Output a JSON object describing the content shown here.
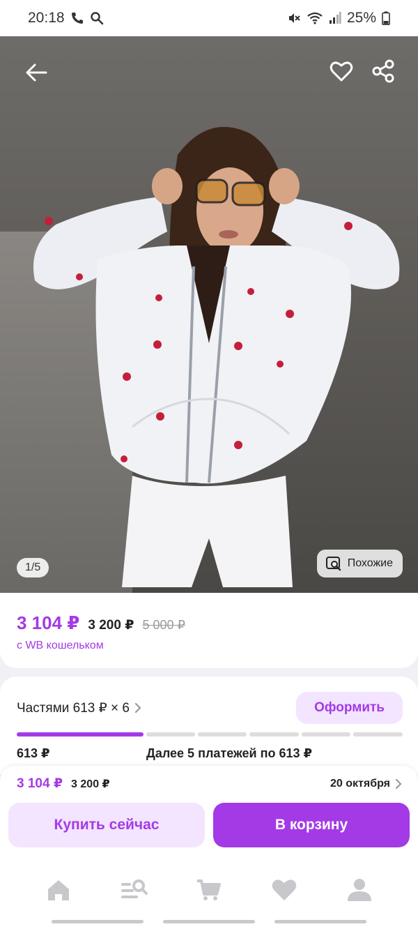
{
  "status_bar": {
    "time": "20:18",
    "battery": "25%"
  },
  "gallery": {
    "counter": "1/5",
    "similar_label": "Похожие",
    "icons": [
      "back-arrow-icon",
      "heart-outline-icon",
      "share-icon"
    ]
  },
  "price": {
    "wallet_price": "3 104 ₽",
    "price": "3 200 ₽",
    "old_price": "5 000 ₽",
    "wallet_note": "с WB кошельком"
  },
  "installments": {
    "title": "Частями 613 ₽ × 6",
    "checkout_label": "Оформить",
    "first_payment": "613 ₽",
    "rest_payments": "Далее 5 платежей по 613 ₽",
    "segments_paid": 1,
    "segments_total": 6
  },
  "buy_bar": {
    "wallet_price": "3 104 ₽",
    "price": "3 200 ₽",
    "delivery_date": "20 октября",
    "buy_now_label": "Купить сейчас",
    "cart_label": "В корзину"
  },
  "bottom_nav": {
    "items": [
      "home-icon",
      "catalog-search-icon",
      "cart-icon",
      "favorites-heart-icon",
      "profile-icon"
    ]
  },
  "colors": {
    "accent": "#a33ae6",
    "accent_light": "#f3e4ff"
  }
}
